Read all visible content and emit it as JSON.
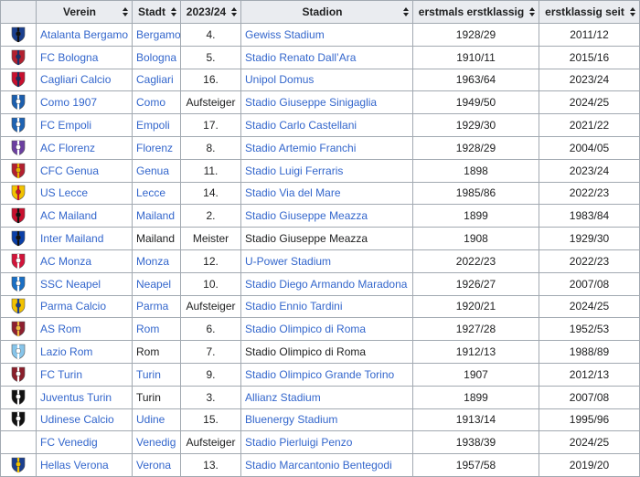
{
  "columns": [
    "",
    "Verein",
    "Stadt",
    "2023/24",
    "Stadion",
    "erstmals erstklassig",
    "erstklassig seit"
  ],
  "rows": [
    {
      "crest": "atalanta-crest-icon",
      "colors": [
        "#1a3f8f",
        "#111111"
      ],
      "club": "Atalanta Bergamo",
      "club_link": true,
      "city": "Bergamo",
      "city_link": true,
      "season": "4.",
      "stadium": "Gewiss Stadium",
      "stadium_link": true,
      "first": "1928/29",
      "since": "2011/12"
    },
    {
      "crest": "bologna-crest-icon",
      "colors": [
        "#b3202f",
        "#1a2f6b"
      ],
      "club": "FC Bologna",
      "club_link": true,
      "city": "Bologna",
      "city_link": true,
      "season": "5.",
      "stadium": "Stadio Renato Dall’Ara",
      "stadium_link": true,
      "first": "1910/11",
      "since": "2015/16"
    },
    {
      "crest": "cagliari-crest-icon",
      "colors": [
        "#c8102e",
        "#1b2a5e"
      ],
      "club": "Cagliari Calcio",
      "club_link": true,
      "city": "Cagliari",
      "city_link": true,
      "season": "16.",
      "stadium": "Unipol Domus",
      "stadium_link": true,
      "first": "1963/64",
      "since": "2023/24"
    },
    {
      "crest": "como-crest-icon",
      "colors": [
        "#1c5fae",
        "#ffffff"
      ],
      "club": "Como 1907",
      "club_link": true,
      "city": "Como",
      "city_link": true,
      "season": "Aufsteiger",
      "stadium": "Stadio Giuseppe Sinigaglia",
      "stadium_link": true,
      "first": "1949/50",
      "since": "2024/25"
    },
    {
      "crest": "empoli-crest-icon",
      "colors": [
        "#1e63b3",
        "#ffffff"
      ],
      "club": "FC Empoli",
      "club_link": true,
      "city": "Empoli",
      "city_link": true,
      "season": "17.",
      "stadium": "Stadio Carlo Castellani",
      "stadium_link": true,
      "first": "1929/30",
      "since": "2021/22"
    },
    {
      "crest": "fiorentina-crest-icon",
      "colors": [
        "#6b3fa0",
        "#ffffff"
      ],
      "club": "AC Florenz",
      "club_link": true,
      "city": "Florenz",
      "city_link": true,
      "season": "8.",
      "stadium": "Stadio Artemio Franchi",
      "stadium_link": true,
      "first": "1928/29",
      "since": "2004/05"
    },
    {
      "crest": "genoa-crest-icon",
      "colors": [
        "#b3202f",
        "#e8b400"
      ],
      "club": "CFC Genua",
      "club_link": true,
      "city": "Genua",
      "city_link": true,
      "season": "11.",
      "stadium": "Stadio Luigi Ferraris",
      "stadium_link": true,
      "first": "1898",
      "since": "2023/24"
    },
    {
      "crest": "lecce-crest-icon",
      "colors": [
        "#f2c200",
        "#c8102e"
      ],
      "club": "US Lecce",
      "club_link": true,
      "city": "Lecce",
      "city_link": true,
      "season": "14.",
      "stadium": "Stadio Via del Mare",
      "stadium_link": true,
      "first": "1985/86",
      "since": "2022/23"
    },
    {
      "crest": "milan-crest-icon",
      "colors": [
        "#c8102e",
        "#111111"
      ],
      "club": "AC Mailand",
      "club_link": true,
      "city": "Mailand",
      "city_link": true,
      "season": "2.",
      "stadium": "Stadio Giuseppe Meazza",
      "stadium_link": true,
      "first": "1899",
      "since": "1983/84"
    },
    {
      "crest": "inter-crest-icon",
      "colors": [
        "#0a3fa8",
        "#111111"
      ],
      "club": "Inter Mailand",
      "club_link": true,
      "city": "Mailand",
      "city_link": false,
      "season": "Meister",
      "stadium": "Stadio Giuseppe Meazza",
      "stadium_link": false,
      "first": "1908",
      "since": "1929/30"
    },
    {
      "crest": "monza-crest-icon",
      "colors": [
        "#d2143a",
        "#ffffff"
      ],
      "club": "AC Monza",
      "club_link": true,
      "city": "Monza",
      "city_link": true,
      "season": "12.",
      "stadium": "U-Power Stadium",
      "stadium_link": true,
      "first": "2022/23",
      "since": "2022/23"
    },
    {
      "crest": "napoli-crest-icon",
      "colors": [
        "#1a6fc4",
        "#ffffff"
      ],
      "club": "SSC Neapel",
      "club_link": true,
      "city": "Neapel",
      "city_link": true,
      "season": "10.",
      "stadium": "Stadio Diego Armando Maradona",
      "stadium_link": true,
      "first": "1926/27",
      "since": "2007/08"
    },
    {
      "crest": "parma-crest-icon",
      "colors": [
        "#f2c200",
        "#1a3f8f"
      ],
      "club": "Parma Calcio",
      "club_link": true,
      "city": "Parma",
      "city_link": true,
      "season": "Aufsteiger",
      "stadium": "Stadio Ennio Tardini",
      "stadium_link": true,
      "first": "1920/21",
      "since": "2024/25"
    },
    {
      "crest": "roma-crest-icon",
      "colors": [
        "#8e1f2f",
        "#f0bc42"
      ],
      "club": "AS Rom",
      "club_link": true,
      "city": "Rom",
      "city_link": true,
      "season": "6.",
      "stadium": "Stadio Olimpico di Roma",
      "stadium_link": true,
      "first": "1927/28",
      "since": "1952/53"
    },
    {
      "crest": "lazio-crest-icon",
      "colors": [
        "#87c5ea",
        "#ffffff"
      ],
      "club": "Lazio Rom",
      "club_link": true,
      "city": "Rom",
      "city_link": false,
      "season": "7.",
      "stadium": "Stadio Olimpico di Roma",
      "stadium_link": false,
      "first": "1912/13",
      "since": "1988/89"
    },
    {
      "crest": "torino-crest-icon",
      "colors": [
        "#8a1f2b",
        "#ffffff"
      ],
      "club": "FC Turin",
      "club_link": true,
      "city": "Turin",
      "city_link": true,
      "season": "9.",
      "stadium": "Stadio Olimpico Grande Torino",
      "stadium_link": true,
      "first": "1907",
      "since": "2012/13"
    },
    {
      "crest": "juventus-crest-icon",
      "colors": [
        "#111111",
        "#ffffff"
      ],
      "club": "Juventus Turin",
      "club_link": true,
      "city": "Turin",
      "city_link": false,
      "season": "3.",
      "stadium": "Allianz Stadium",
      "stadium_link": true,
      "first": "1899",
      "since": "2007/08"
    },
    {
      "crest": "udinese-crest-icon",
      "colors": [
        "#111111",
        "#ffffff"
      ],
      "club": "Udinese Calcio",
      "club_link": true,
      "city": "Udine",
      "city_link": true,
      "season": "15.",
      "stadium": "Bluenergy Stadium",
      "stadium_link": true,
      "first": "1913/14",
      "since": "1995/96"
    },
    {
      "crest": "",
      "colors": [
        "#ffffff",
        "#ffffff"
      ],
      "club": "FC Venedig",
      "club_link": true,
      "city": "Venedig",
      "city_link": true,
      "season": "Aufsteiger",
      "stadium": "Stadio Pierluigi Penzo",
      "stadium_link": true,
      "first": "1938/39",
      "since": "2024/25"
    },
    {
      "crest": "verona-crest-icon",
      "colors": [
        "#1a3f8f",
        "#f2c200"
      ],
      "club": "Hellas Verona",
      "club_link": true,
      "city": "Verona",
      "city_link": true,
      "season": "13.",
      "stadium": "Stadio Marcantonio Bentegodi",
      "stadium_link": true,
      "first": "1957/58",
      "since": "2019/20"
    }
  ]
}
